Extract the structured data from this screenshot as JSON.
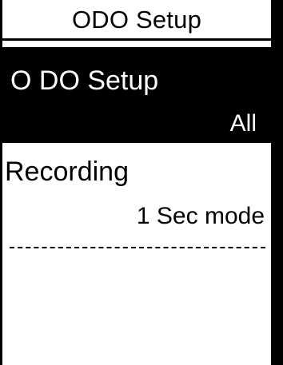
{
  "header": {
    "title": "ODO Setup"
  },
  "menu": {
    "items": [
      {
        "label": "O DO Setup",
        "value": "All",
        "selected": true
      },
      {
        "label": "Recording",
        "value": "1 Sec mode",
        "selected": false
      }
    ]
  },
  "colors": {
    "background": "#ffffff",
    "foreground": "#000000",
    "highlight": "#000000",
    "highlight_text": "#ffffff"
  }
}
